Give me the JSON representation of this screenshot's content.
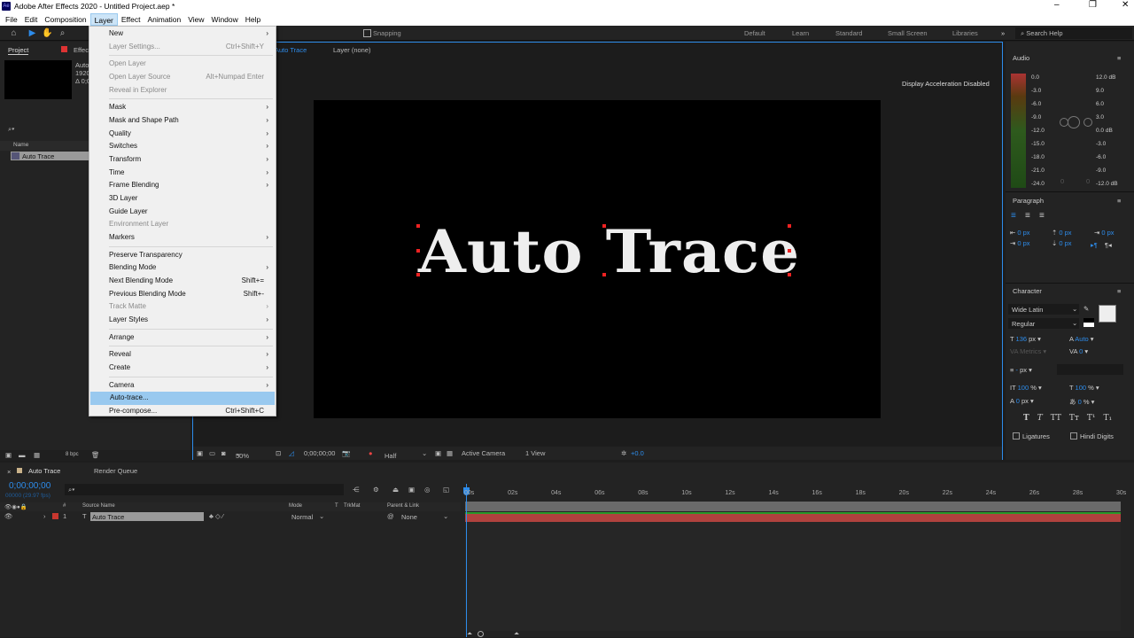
{
  "window": {
    "title": "Adobe After Effects 2020 - Untitled Project.aep *",
    "logo": "Ae"
  },
  "menubar": [
    "File",
    "Edit",
    "Composition",
    "Layer",
    "Effect",
    "Animation",
    "View",
    "Window",
    "Help"
  ],
  "toolbar": {
    "snapping": "Snapping"
  },
  "workspaces": [
    "Default",
    "Learn",
    "Standard",
    "Small Screen",
    "Libraries"
  ],
  "search_help": "Search Help",
  "project": {
    "tab": "Project",
    "effects_tab": "Effects",
    "info_name": "Auto",
    "info_size": "1920",
    "info_dur": "Δ 0;0",
    "column_name": "Name",
    "item": "Auto Trace",
    "bpc": "8 bpc"
  },
  "viewer": {
    "comp_tab": "Auto Trace",
    "layer_tab": "Layer (none)",
    "notice": "Display Acceleration Disabled",
    "comp_text": "Auto Trace",
    "zoom": "50%",
    "timecode": "0;00;00;00",
    "resolution": "Half",
    "camera": "Active Camera",
    "views": "1 View",
    "exposure": "+0.0"
  },
  "layer_menu": [
    {
      "label": "New",
      "submenu": true
    },
    {
      "label": "Layer Settings...",
      "shortcut": "Ctrl+Shift+Y",
      "disabled": true
    },
    {
      "sep": true
    },
    {
      "label": "Open Layer",
      "disabled": true
    },
    {
      "label": "Open Layer Source",
      "shortcut": "Alt+Numpad Enter",
      "disabled": true
    },
    {
      "label": "Reveal in Explorer",
      "disabled": true
    },
    {
      "sep": true
    },
    {
      "label": "Mask",
      "submenu": true
    },
    {
      "label": "Mask and Shape Path",
      "submenu": true
    },
    {
      "label": "Quality",
      "submenu": true
    },
    {
      "label": "Switches",
      "submenu": true
    },
    {
      "label": "Transform",
      "submenu": true
    },
    {
      "label": "Time",
      "submenu": true
    },
    {
      "label": "Frame Blending",
      "submenu": true
    },
    {
      "label": "3D Layer"
    },
    {
      "label": "Guide Layer"
    },
    {
      "label": "Environment Layer",
      "disabled": true
    },
    {
      "label": "Markers",
      "submenu": true
    },
    {
      "sep": true
    },
    {
      "label": "Preserve Transparency"
    },
    {
      "label": "Blending Mode",
      "submenu": true
    },
    {
      "label": "Next Blending Mode",
      "shortcut": "Shift+="
    },
    {
      "label": "Previous Blending Mode",
      "shortcut": "Shift+-"
    },
    {
      "label": "Track Matte",
      "submenu": true,
      "disabled": true
    },
    {
      "label": "Layer Styles",
      "submenu": true
    },
    {
      "sep": true
    },
    {
      "label": "Arrange",
      "submenu": true
    },
    {
      "sep": true
    },
    {
      "label": "Reveal",
      "submenu": true
    },
    {
      "label": "Create",
      "submenu": true
    },
    {
      "sep": true
    },
    {
      "label": "Camera",
      "submenu": true
    },
    {
      "label": "Auto-trace...",
      "highlighted": true
    },
    {
      "label": "Pre-compose...",
      "shortcut": "Ctrl+Shift+C"
    }
  ],
  "audio": {
    "title": "Audio",
    "left_scale": [
      "0.0",
      "-3.0",
      "-6.0",
      "-9.0",
      "-12.0",
      "-15.0",
      "-18.0",
      "-21.0",
      "-24.0"
    ],
    "right_scale": [
      "12.0 dB",
      "9.0",
      "6.0",
      "3.0",
      "0.0 dB",
      "-3.0",
      "-6.0",
      "-9.0",
      "-12.0 dB"
    ],
    "slider_vals": [
      "0",
      "0"
    ]
  },
  "paragraph": {
    "title": "Paragraph",
    "indent_left": "0 px",
    "indent_right": "0 px",
    "space_before": "0 px",
    "space_after": "0 px",
    "first_line": "0 px",
    "unit": "px"
  },
  "character": {
    "title": "Character",
    "font": "Wide Latin",
    "style": "Regular",
    "size": "136",
    "size_unit": "px",
    "leading": "Auto",
    "kerning": "Metrics",
    "tracking": "0",
    "stroke": "-",
    "stroke_unit": "px",
    "vscale": "100",
    "hscale": "100",
    "pct": "%",
    "baseline": "0",
    "baseline_unit": "px",
    "tsume": "0",
    "ligatures": "Ligatures",
    "hindi_digits": "Hindi Digits",
    "styles": [
      "T",
      "T",
      "TT",
      "Tт",
      "T¹",
      "T₁"
    ]
  },
  "timeline": {
    "tab": "Auto Trace",
    "render_queue": "Render Queue",
    "timecode": "0;00;00;00",
    "frame_info": "00000 (29.97 fps)",
    "columns": {
      "num": "#",
      "source": "Source Name",
      "mode": "Mode",
      "t": "T",
      "trkmat": "TrkMat",
      "parent": "Parent & Link"
    },
    "layer": {
      "index": "1",
      "name": "Auto Trace",
      "mode": "Normal",
      "parent": "None",
      "type": "T"
    },
    "ticks": [
      "00s",
      "02s",
      "04s",
      "06s",
      "08s",
      "10s",
      "12s",
      "14s",
      "16s",
      "18s",
      "20s",
      "22s",
      "24s",
      "26s",
      "28s",
      "30s"
    ],
    "colors": {
      "layer_bar": "#b0423e",
      "label": "#c8372f"
    }
  }
}
